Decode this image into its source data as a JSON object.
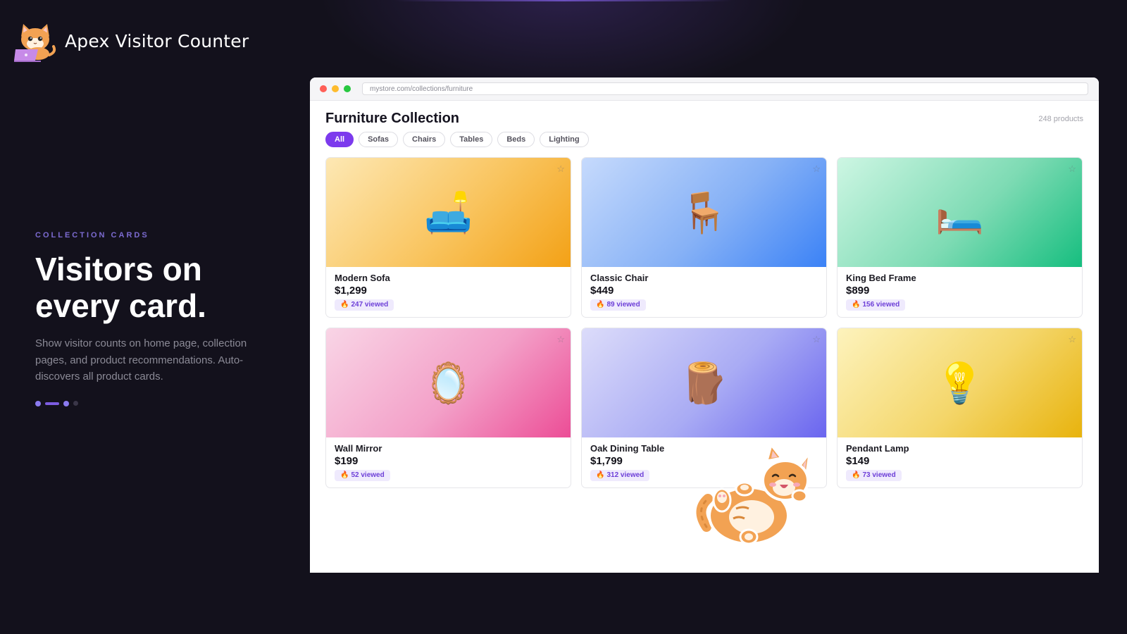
{
  "brand": {
    "name": "Apex Visitor Counter"
  },
  "hero": {
    "eyebrow": "COLLECTION CARDS",
    "headline_line1": "Visitors on",
    "headline_line2": "every card.",
    "description": "Show visitor counts on home page, collection pages, and product recommendations. Auto-discovers all product cards."
  },
  "browser": {
    "url": "mystore.com/collections/furniture"
  },
  "page": {
    "title": "Furniture Collection",
    "count": "248 products",
    "filters": [
      {
        "label": "All",
        "active": true
      },
      {
        "label": "Sofas",
        "active": false
      },
      {
        "label": "Chairs",
        "active": false
      },
      {
        "label": "Tables",
        "active": false
      },
      {
        "label": "Beds",
        "active": false
      },
      {
        "label": "Lighting",
        "active": false
      }
    ]
  },
  "products": [
    {
      "name": "Modern Sofa",
      "price": "$1,299",
      "views": "247 viewed",
      "emoji": "🛋️"
    },
    {
      "name": "Classic Chair",
      "price": "$449",
      "views": "89 viewed",
      "emoji": "🪑"
    },
    {
      "name": "King Bed Frame",
      "price": "$899",
      "views": "156 viewed",
      "emoji": "🛏️"
    },
    {
      "name": "Wall Mirror",
      "price": "$199",
      "views": "52 viewed",
      "emoji": "🪞"
    },
    {
      "name": "Oak Dining Table",
      "price": "$1,799",
      "views": "312 viewed",
      "emoji": "🪵"
    },
    {
      "name": "Pendant Lamp",
      "price": "$149",
      "views": "73 viewed",
      "emoji": "💡"
    }
  ],
  "icons": {
    "star": "☆",
    "fire": "🔥"
  },
  "colors": {
    "accent": "#7c3aed",
    "background": "#13111c",
    "badge_bg": "#efeafd",
    "badge_text": "#6d3fd8"
  }
}
